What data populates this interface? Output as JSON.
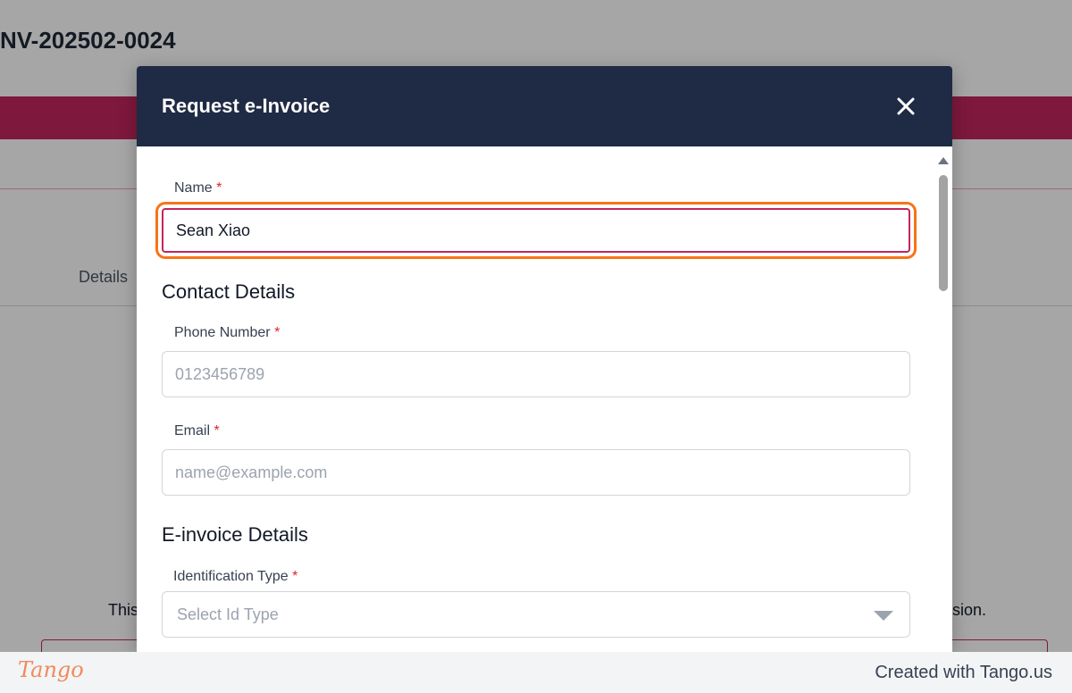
{
  "background": {
    "invoice_number": "NV-202502-0024",
    "details_tab": "Details",
    "desc_left": "This",
    "desc_right": "sion."
  },
  "modal": {
    "title": "Request e-Invoice",
    "name": {
      "label": "Name",
      "required": "*",
      "value": "Sean Xiao"
    },
    "contact_heading": "Contact Details",
    "phone": {
      "label": "Phone Number",
      "required": "*",
      "placeholder": "0123456789"
    },
    "email": {
      "label": "Email",
      "required": "*",
      "placeholder": "name@example.com"
    },
    "einvoice_heading": "E-invoice Details",
    "id_type": {
      "label": "Identification Type",
      "required": "*",
      "placeholder": "Select Id Type"
    }
  },
  "footer": {
    "logo": "Tango",
    "created_with": "Created with Tango.us"
  },
  "colors": {
    "header_bg": "#1f2a44",
    "brand": "#c2255c",
    "highlight": "#f97316",
    "required": "#dc2626"
  },
  "icons": {
    "close": "close-icon",
    "dropdown": "chevron-down-icon",
    "scroll_up": "scroll-up-arrow-icon"
  }
}
